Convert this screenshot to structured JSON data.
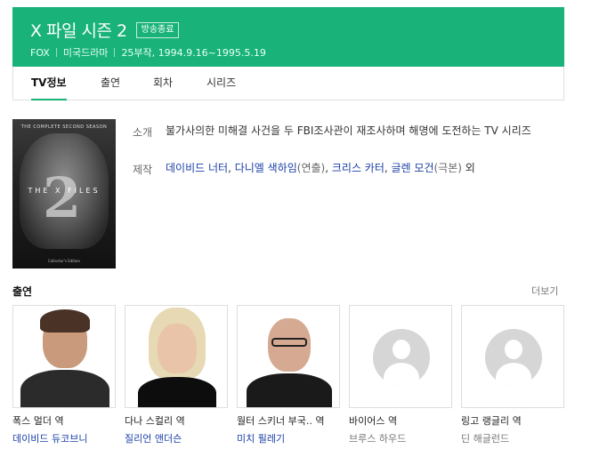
{
  "header": {
    "title": "X 파일 시즌 2",
    "badge": "방송종료",
    "meta": [
      "FOX",
      "미국드라마",
      "25부작, 1994.9.16~1995.5.19"
    ]
  },
  "tabs": [
    {
      "label": "TV정보",
      "active": true
    },
    {
      "label": "출연",
      "active": false
    },
    {
      "label": "회차",
      "active": false
    },
    {
      "label": "시리즈",
      "active": false
    }
  ],
  "poster": {
    "top_text": "THE COMPLETE SECOND SEASON",
    "logo_text": "THE X FILES",
    "number": "2",
    "bottom_text": "Collector's Edition"
  },
  "info": {
    "intro_label": "소개",
    "intro_text": "불가사의한 미해결 사건을 두 FBI조사관이 재조사하며 해명에 도전하는 TV 시리즈",
    "staff_label": "제작",
    "staff": [
      {
        "name": "데이비드 너터",
        "role": ""
      },
      {
        "name": "다니엘 색하임",
        "role": "(연출)"
      },
      {
        "name": "크리스 카터",
        "role": ""
      },
      {
        "name": "글렌 모건",
        "role": "(극본)"
      }
    ],
    "staff_suffix": "외"
  },
  "cast": {
    "title": "출연",
    "more_label": "더보기",
    "members": [
      {
        "role": "폭스 멀더 역",
        "actor": "데이비드 듀코브니",
        "linked": true,
        "photo": "photo"
      },
      {
        "role": "다나 스컬리 역",
        "actor": "질리언 앤더슨",
        "linked": true,
        "photo": "photo"
      },
      {
        "role": "월터 스키너 부국.. 역",
        "actor": "미치 필레기",
        "linked": true,
        "photo": "photo"
      },
      {
        "role": "바이어스 역",
        "actor": "브루스 하우드",
        "linked": false,
        "photo": "placeholder"
      },
      {
        "role": "링고 랭글리 역",
        "actor": "딘 해글런드",
        "linked": false,
        "photo": "placeholder"
      }
    ]
  },
  "colors": {
    "brand_green": "#19b37a",
    "link_blue": "#1b3fa8"
  }
}
